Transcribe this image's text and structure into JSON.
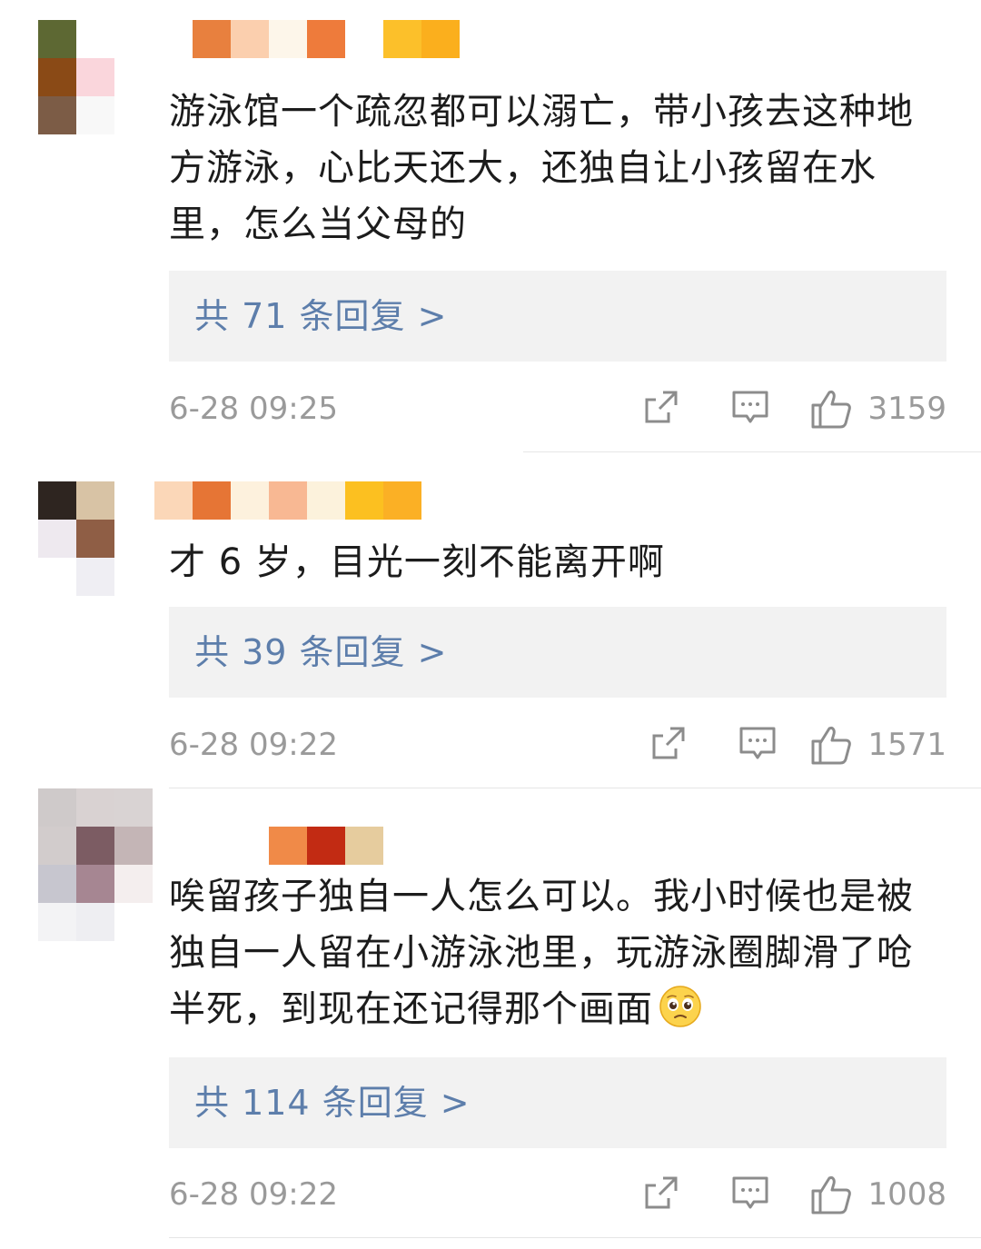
{
  "comments": [
    {
      "text": "游泳馆一个疏忽都可以溺亡，带小孩去这种地方游泳，心比天还大，还独自让小孩留在水里，怎么当父母的",
      "reply_label": "共 71 条回复 >",
      "timestamp": "6-28 09:25",
      "likes": "3159",
      "avatar_colors": [
        "#5d6833",
        "#ffffff",
        "#ffffff",
        "#8a4a16",
        "#fad6dc",
        "#ffffff",
        "#7c5c46",
        "#f8f8f8",
        "#ffffff"
      ],
      "username_colors": [
        "#e8803e",
        "#fbcfae",
        "#fdf6ea",
        "#ee7b3b",
        "#ffffff",
        "#fcc02a",
        "#fbaf1d"
      ]
    },
    {
      "text": "才 6 岁，目光一刻不能离开啊",
      "reply_label": "共 39 条回复 >",
      "timestamp": "6-28 09:22",
      "likes": "1571",
      "avatar_colors": [
        "#2e2520",
        "#d8c3a5",
        "#ffffff",
        "#eee9ef",
        "#8f5e45",
        "#ffffff",
        "#ffffff",
        "#efeef3",
        "#ffffff"
      ],
      "username_colors": [
        "#fbd7b8",
        "#e67535",
        "#fdf1dd",
        "#f8b893",
        "#fcf2dc",
        "#fcc020",
        "#fbb025"
      ]
    },
    {
      "text": "唉留孩子独自一人怎么可以。我小时候也是被独自一人留在小游泳池里，玩游泳圈脚滑了呛半死，到现在还记得那个画面",
      "reply_label": "共 114 条回复 >",
      "timestamp": "6-28 09:22",
      "likes": "1008",
      "avatar_colors": [
        "#cfcaca",
        "#d9d2d2",
        "#d9d3d3",
        "#d2cccc",
        "#7c5c63",
        "#c4b5b6",
        "#c7c6cf",
        "#a68692",
        "#f4eeee",
        "#f3f3f5",
        "#eeeef2",
        "#ffffff"
      ],
      "username_colors": [
        "#ffffff",
        "#ffffff",
        "#f08a48",
        "#c22b13",
        "#e6cc9e"
      ]
    }
  ]
}
